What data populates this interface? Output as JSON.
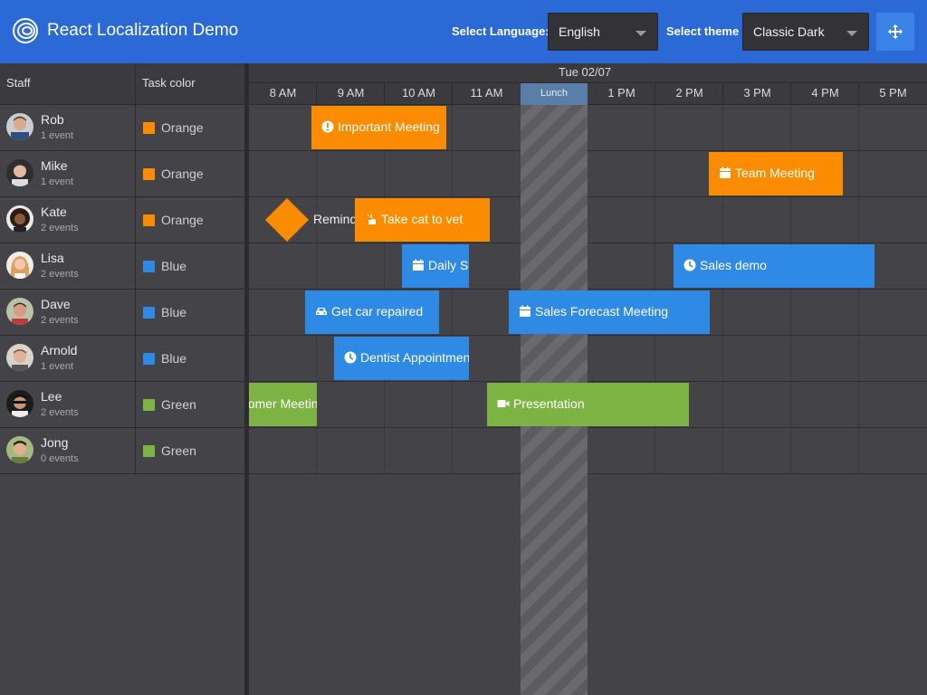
{
  "header": {
    "title": "React Localization Demo",
    "language_label": "Select Language:",
    "language_value": "English",
    "theme_label": "Select theme",
    "theme_value": "Classic Dark",
    "fullscreen_icon": "move-arrows-icon",
    "accent_color": "#2b6ad6"
  },
  "grid": {
    "columns": [
      "Staff",
      "Task color"
    ],
    "rows": [
      {
        "name": "Rob",
        "events": "1 event",
        "color": "Orange",
        "swatch": "#fb8c00"
      },
      {
        "name": "Mike",
        "events": "1 event",
        "color": "Orange",
        "swatch": "#fb8c00"
      },
      {
        "name": "Kate",
        "events": "2 events",
        "color": "Orange",
        "swatch": "#fb8c00"
      },
      {
        "name": "Lisa",
        "events": "2 events",
        "color": "Blue",
        "swatch": "#2f8ae6"
      },
      {
        "name": "Dave",
        "events": "2 events",
        "color": "Blue",
        "swatch": "#2f8ae6"
      },
      {
        "name": "Arnold",
        "events": "1 event",
        "color": "Blue",
        "swatch": "#2f8ae6"
      },
      {
        "name": "Lee",
        "events": "2 events",
        "color": "Green",
        "swatch": "#7cb342"
      },
      {
        "name": "Jong",
        "events": "0 events",
        "color": "Green",
        "swatch": "#7cb342"
      }
    ]
  },
  "scheduler": {
    "date": "Tue 02/07",
    "hours": [
      "8 AM",
      "9 AM",
      "10 AM",
      "11 AM",
      "1 PM",
      "2 PM",
      "3 PM",
      "4 PM",
      "5 PM"
    ],
    "lunch_label": "Lunch",
    "events": {
      "important_meeting": "Important Meeting",
      "team_meeting": "Team Meeting",
      "reminder": "Reminder",
      "take_cat": "Take cat to vet",
      "daily_standup": "Daily Stand-up",
      "sales_demo": "Sales demo",
      "car_repair": "Get car repaired",
      "sales_forecast": "Sales Forecast Meeting",
      "dentist": "Dentist Appointment",
      "customer_meeting": "Customer Meeting",
      "presentation": "Presentation"
    }
  }
}
